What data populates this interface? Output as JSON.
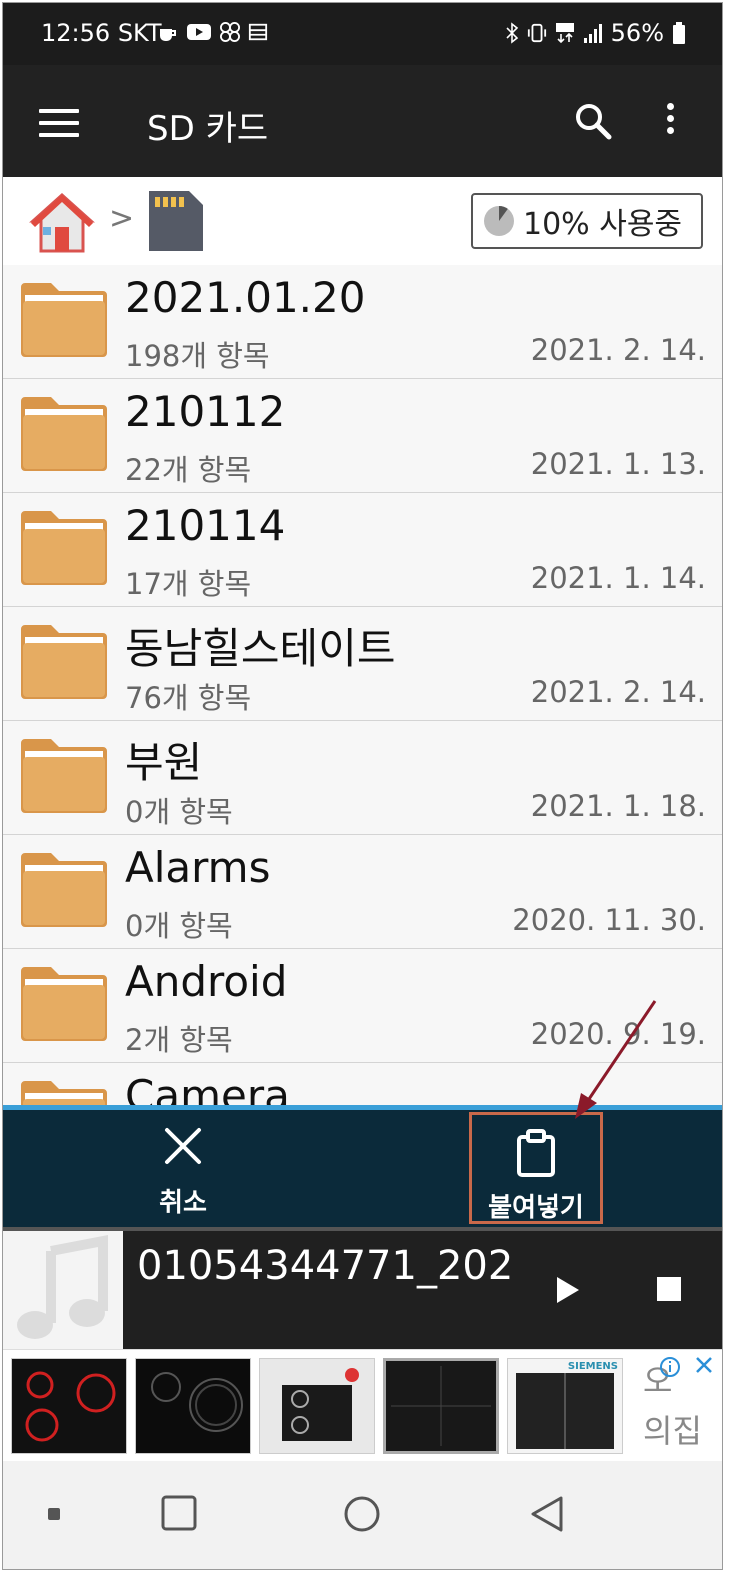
{
  "status_bar": {
    "time": "12:56",
    "carrier": "SKT",
    "battery": "56%",
    "icons": [
      "cafe-icon",
      "youtube-icon",
      "pinwheel-icon",
      "list-icon",
      "bluetooth-icon",
      "vibrate-icon",
      "lte-icon",
      "signal-icon",
      "battery-icon"
    ]
  },
  "app_bar": {
    "title": "SD 카드",
    "icons": [
      "menu-icon",
      "search-icon",
      "more-icon"
    ]
  },
  "breadcrumb": {
    "separator": ">",
    "usage_label": "10% 사용중",
    "usage_fraction": 0.1
  },
  "files": [
    {
      "name": "2021.01.20",
      "count": "198개 항목",
      "date": "2021. 2. 14."
    },
    {
      "name": "210112",
      "count": "22개 항목",
      "date": "2021. 1. 13."
    },
    {
      "name": "210114",
      "count": "17개 항목",
      "date": "2021. 1. 14."
    },
    {
      "name": "동남힐스테이트",
      "count": "76개 항목",
      "date": "2021. 2. 14."
    },
    {
      "name": "부원",
      "count": "0개 항목",
      "date": "2021. 1. 18."
    },
    {
      "name": "Alarms",
      "count": "0개 항목",
      "date": "2020. 11. 30."
    },
    {
      "name": "Android",
      "count": "2개 항목",
      "date": "2020. 9. 19."
    },
    {
      "name": "Camera",
      "count": "",
      "date": ""
    }
  ],
  "actions": {
    "cancel_label": "취소",
    "paste_label": "붙여넣기"
  },
  "player": {
    "track": "01054344771_202"
  },
  "ad": {
    "text_line1": "오",
    "text_line2": "의집",
    "brand": "SIEMENS"
  },
  "colors": {
    "app_bar": "#222222",
    "action_bar": "#0b2a3a",
    "accent_line": "#3a9fd8",
    "folder": "#e3a85c",
    "highlight": "#c9694a"
  }
}
